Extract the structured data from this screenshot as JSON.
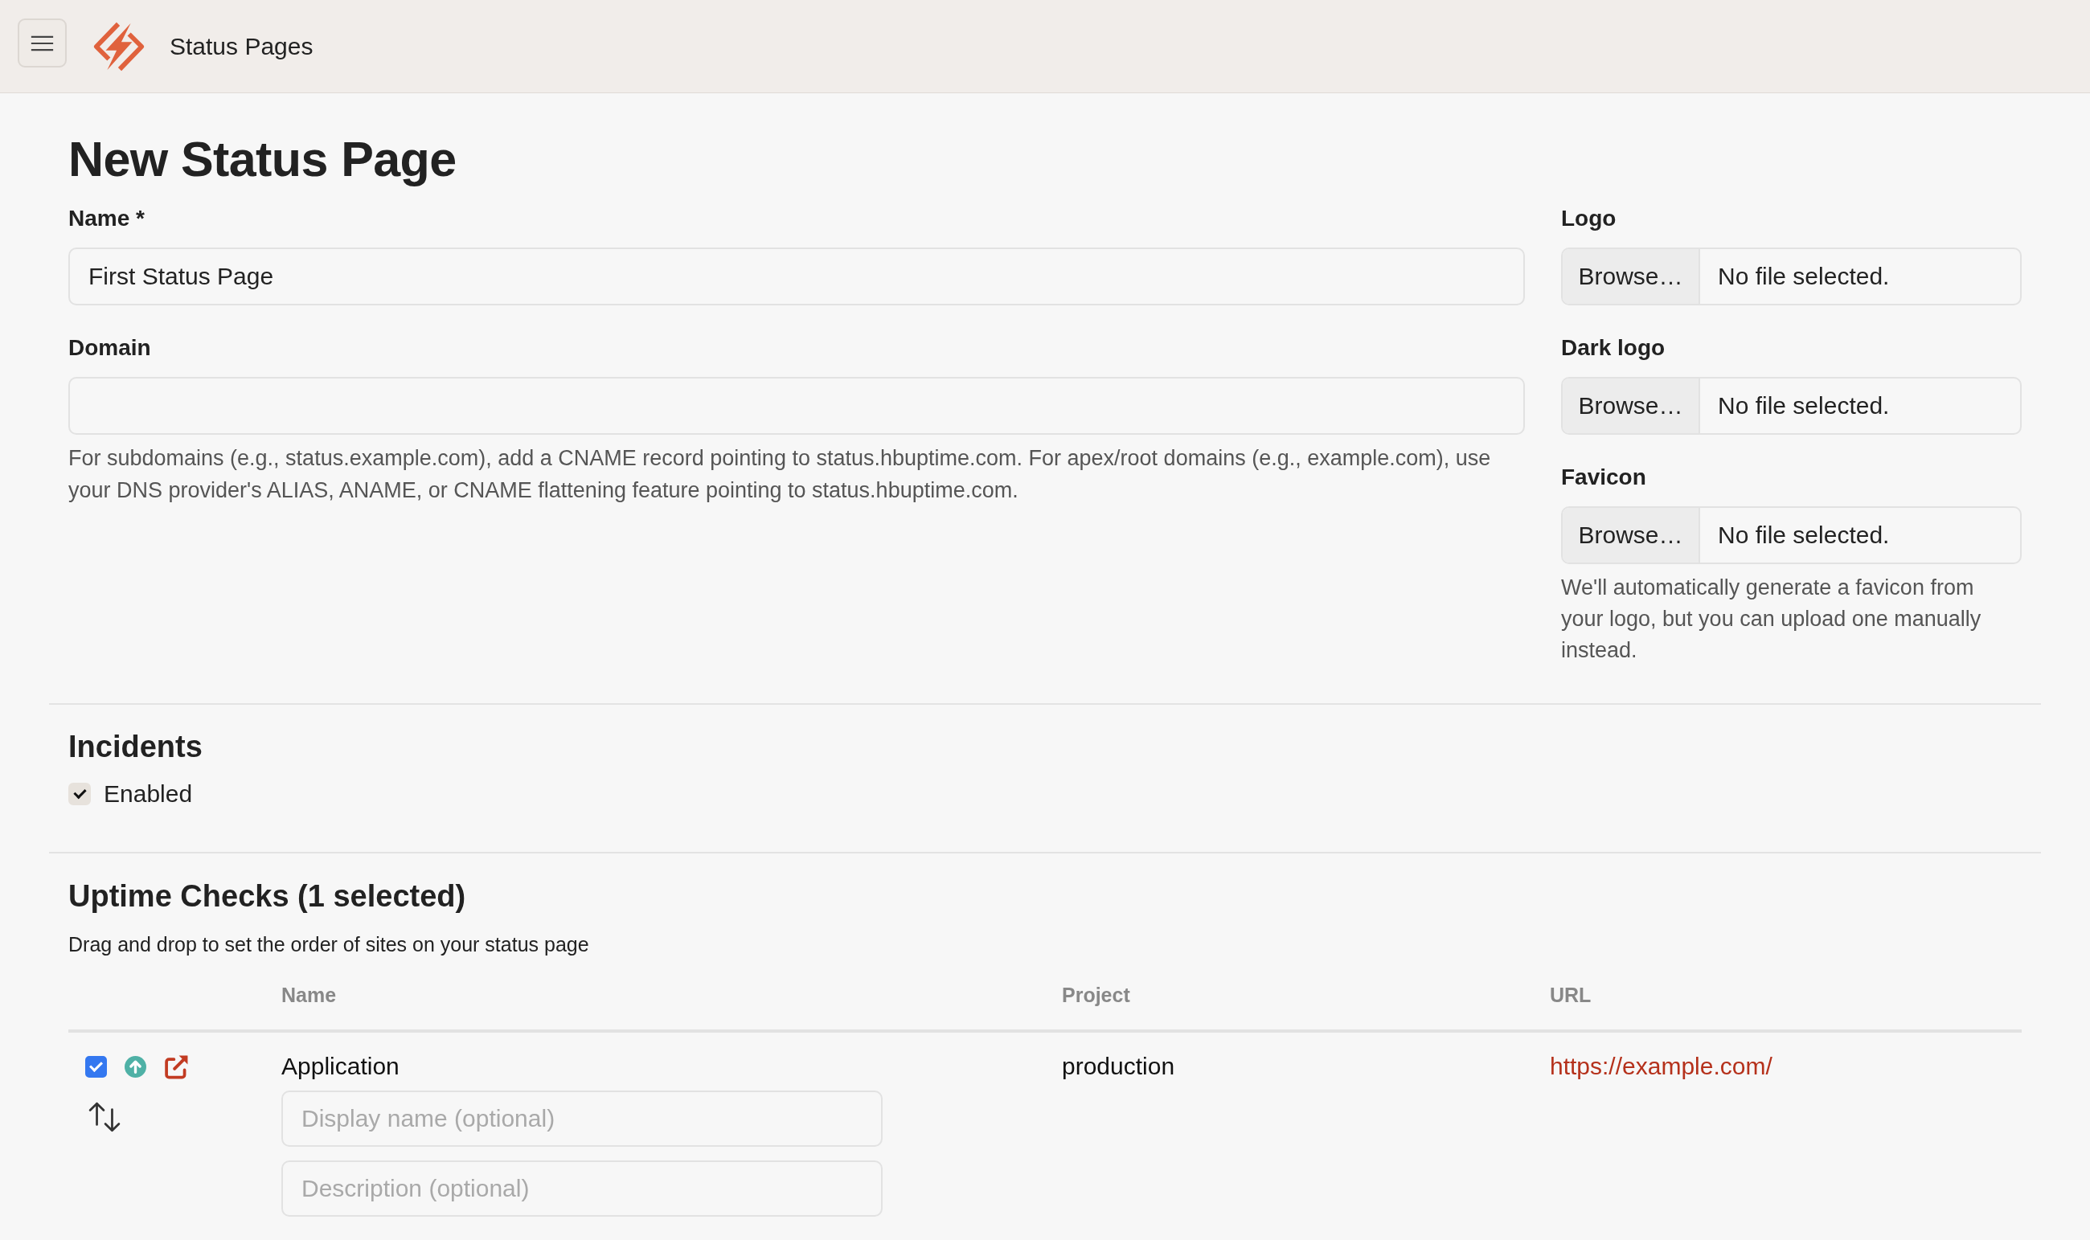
{
  "header": {
    "title": "Status Pages"
  },
  "page_title": "New Status Page",
  "fields": [
    {
      "label": "Name *",
      "value": "First Status Page"
    },
    {
      "label": "Domain",
      "help": "For subdomains (e.g., status.example.com), add a CNAME record pointing to status.hbuptime.com. For apex/root domains (e.g., example.com), use your DNS provider's ALIAS, ANAME, or CNAME flattening feature pointing to status.hbuptime.com."
    }
  ],
  "files": [
    {
      "label": "Logo",
      "button": "Browse…",
      "status": "No file selected."
    },
    {
      "label": "Dark logo",
      "button": "Browse…",
      "status": "No file selected."
    },
    {
      "label": "Favicon",
      "button": "Browse…",
      "status": "No file selected.",
      "help": "We'll automatically generate a favicon from your logo, but you can upload one manually instead."
    }
  ],
  "incidents": {
    "heading": "Incidents",
    "enabled": {
      "label": "Enabled",
      "checked": true
    }
  },
  "uptime_checks": {
    "heading": "Uptime Checks (1 selected)",
    "hint": "Drag and drop to set the order of sites on your status page",
    "columns": [
      "Name",
      "Project",
      "URL"
    ],
    "rows": [
      {
        "checked": true,
        "up": true,
        "name": "Application",
        "display_name_placeholder": "Display name (optional)",
        "description_placeholder": "Description (optional)",
        "project": "production",
        "url": "https://example.com/"
      }
    ]
  }
}
